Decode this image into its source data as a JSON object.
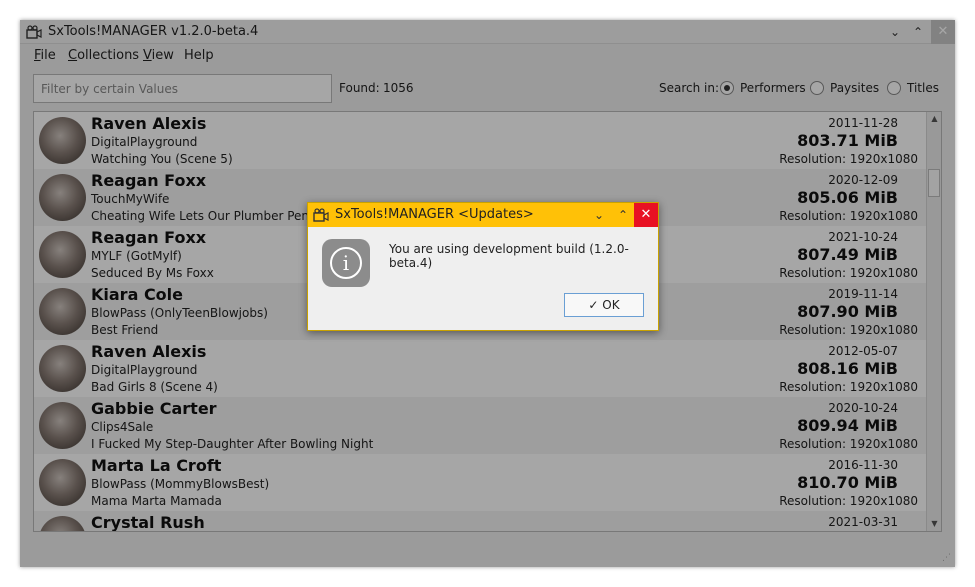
{
  "window": {
    "title": "SxTools!MANAGER v1.2.0-beta.4",
    "minimize_glyph": "⌄",
    "maximize_glyph": "⌃",
    "close_glyph": "✕"
  },
  "menu": {
    "file_u": "F",
    "file_rest": "ile",
    "collections_u": "C",
    "collections_rest": "ollections",
    "view_u": "V",
    "view_rest": "iew",
    "help": "Help"
  },
  "toolbar": {
    "filter_placeholder": "Filter by certain Values",
    "found_label": "Found:",
    "found_count": "1056",
    "search_in_label": "Search in:",
    "options": [
      {
        "label": "Performers",
        "checked": true
      },
      {
        "label": "Paysites",
        "checked": false
      },
      {
        "label": "Titles",
        "checked": false
      }
    ]
  },
  "rows": [
    {
      "performer": "Raven Alexis",
      "paysite": "DigitalPlayground",
      "scene": "Watching You (Scene 5)",
      "date": "2011-11-28",
      "size": "803.71 MiB",
      "resolution": "Resolution: 1920x1080"
    },
    {
      "performer": "Reagan Foxx",
      "paysite": "TouchMyWife",
      "scene": "Cheating Wife Lets Our Plumber Penetra",
      "date": "2020-12-09",
      "size": "805.06 MiB",
      "resolution": "Resolution: 1920x1080"
    },
    {
      "performer": "Reagan Foxx",
      "paysite": "MYLF (GotMylf)",
      "scene": "Seduced By Ms Foxx",
      "date": "2021-10-24",
      "size": "807.49 MiB",
      "resolution": "Resolution: 1920x1080"
    },
    {
      "performer": "Kiara Cole",
      "paysite": "BlowPass (OnlyTeenBlowjobs)",
      "scene": "Best Friend",
      "date": "2019-11-14",
      "size": "807.90 MiB",
      "resolution": "Resolution: 1920x1080"
    },
    {
      "performer": "Raven Alexis",
      "paysite": "DigitalPlayground",
      "scene": "Bad Girls 8 (Scene 4)",
      "date": "2012-05-07",
      "size": "808.16 MiB",
      "resolution": "Resolution: 1920x1080"
    },
    {
      "performer": "Gabbie Carter",
      "paysite": "Clips4Sale",
      "scene": "I Fucked My Step-Daughter After Bowling Night",
      "date": "2020-10-24",
      "size": "809.94 MiB",
      "resolution": "Resolution: 1920x1080"
    },
    {
      "performer": "Marta La Croft",
      "paysite": "BlowPass (MommyBlowsBest)",
      "scene": "Mama Marta Mamada",
      "date": "2016-11-30",
      "size": "810.70 MiB",
      "resolution": "Resolution: 1920x1080"
    },
    {
      "performer": "Crystal Rush",
      "paysite": "",
      "scene": "",
      "date": "2021-03-31",
      "size": "",
      "resolution": ""
    }
  ],
  "dialog": {
    "title": "SxTools!MANAGER <Updates>",
    "message": "You are using development build (1.2.0-beta.4)",
    "ok_label": "OK",
    "info_glyph": "i",
    "minimize_glyph": "⌄",
    "maximize_glyph": "⌃",
    "close_glyph": "✕",
    "check_glyph": "✓"
  },
  "colors": {
    "dialog_titlebar": "#ffc107",
    "dialog_close": "#e81123"
  },
  "icons": {
    "window": "app-camera-icon",
    "dialog": "app-camera-icon",
    "info": "info-icon"
  }
}
